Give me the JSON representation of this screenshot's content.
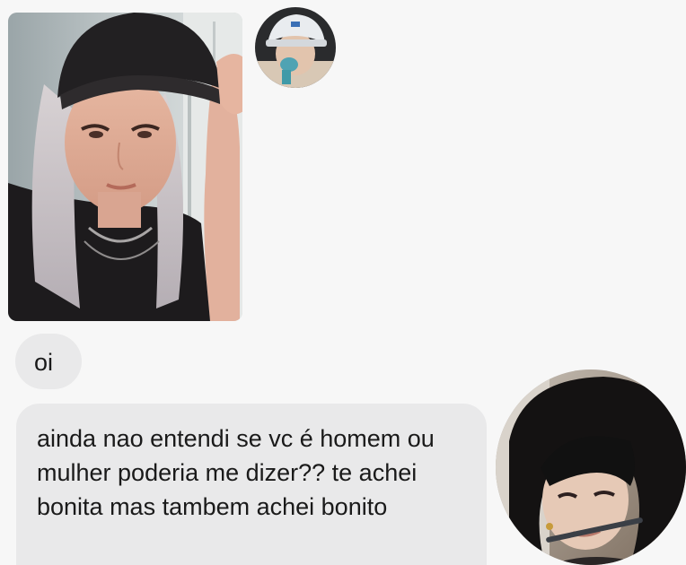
{
  "conversation": {
    "messages": [
      {
        "type": "photo",
        "description_icon": "photo-icon"
      },
      {
        "type": "text",
        "text": "oi"
      },
      {
        "type": "text",
        "text": "ainda nao entendi se vc é homem ou mulher poderia me dizer?? te achei bonita mas tambem achei bonito"
      }
    ]
  },
  "colors": {
    "background": "#f7f7f7",
    "bubble": "#e9e9ea",
    "text": "#1a1a1a"
  }
}
